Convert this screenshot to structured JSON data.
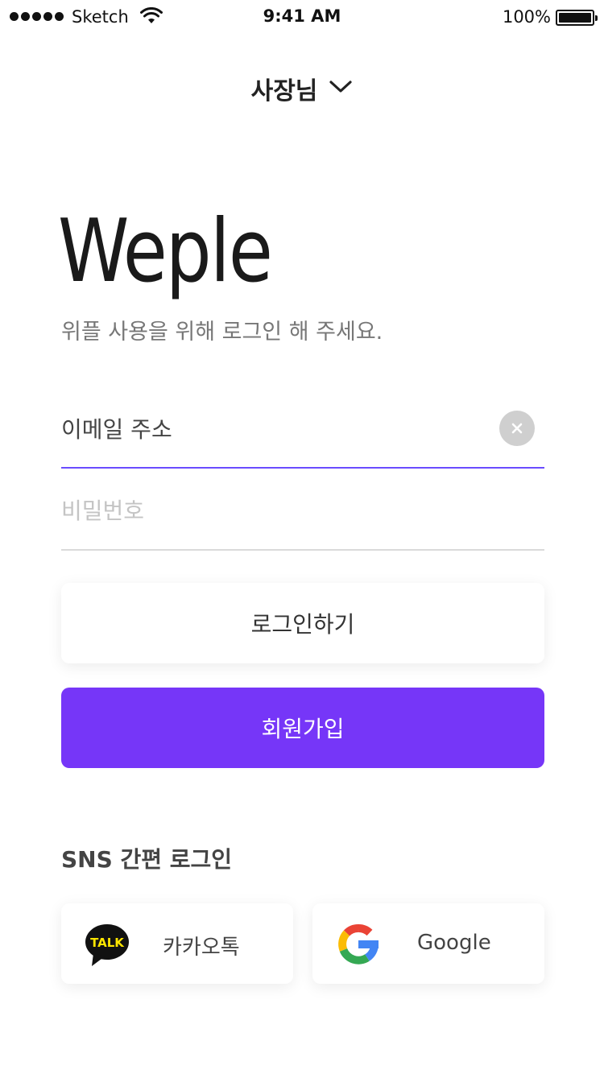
{
  "status_bar": {
    "carrier": "Sketch",
    "time": "9:41 AM",
    "battery": "100%"
  },
  "header": {
    "role_label": "사장님"
  },
  "brand": {
    "logo": "Weple",
    "subtitle": "위플 사용을 위해 로그인 해 주세요."
  },
  "form": {
    "email_value": "이메일 주소",
    "password_placeholder": "비밀번호"
  },
  "buttons": {
    "login": "로그인하기",
    "signup": "회원가입"
  },
  "sns": {
    "title": "SNS 간편 로그인",
    "kakao_label": "카카오톡",
    "kakao_badge": "TALK",
    "google_label": "Google"
  },
  "colors": {
    "accent": "#7636f8",
    "email_underline": "#6a4cff",
    "kakao_yellow": "#fee500"
  },
  "icons": {
    "dropdown": "chevron-down-icon",
    "clear": "close-icon",
    "wifi": "wifi-icon",
    "kakao": "kakaotalk-icon",
    "google": "google-g-icon"
  }
}
